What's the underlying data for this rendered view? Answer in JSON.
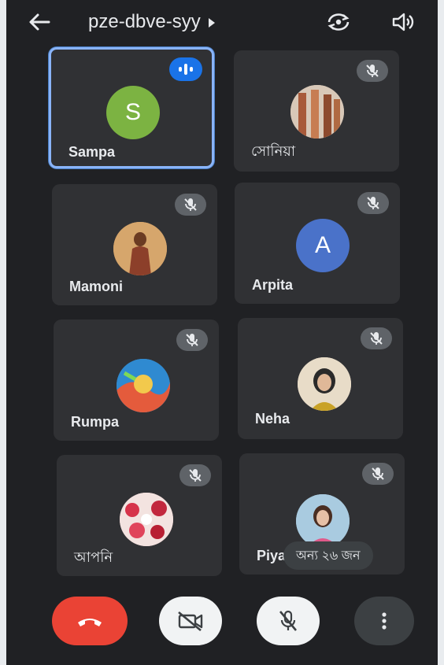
{
  "header": {
    "meeting_code": "pze-dbve-syy",
    "icons": {
      "back": "arrow-left-icon",
      "expand": "play-arrow-icon",
      "switch_camera": "camera-switch-icon",
      "audio": "speaker-icon"
    }
  },
  "participants": [
    {
      "name": "Sampa",
      "avatar_initial": "S",
      "avatar_color": "#7cb342",
      "status": "speaking"
    },
    {
      "name": "সোনিয়া",
      "avatar_initial": "",
      "avatar_color": "#b7a89a",
      "status": "muted"
    },
    {
      "name": "Mamoni",
      "avatar_initial": "",
      "avatar_color": "#c98b52",
      "status": "muted"
    },
    {
      "name": "Arpita",
      "avatar_initial": "A",
      "avatar_color": "#4a72c9",
      "status": "muted"
    },
    {
      "name": "Rumpa",
      "avatar_initial": "",
      "avatar_color": "#3f8ec7",
      "status": "muted"
    },
    {
      "name": "Neha",
      "avatar_initial": "",
      "avatar_color": "#d9c9b3",
      "status": "muted"
    },
    {
      "name": "আপনি",
      "avatar_initial": "",
      "avatar_color": "#e0a3a8",
      "status": "muted"
    },
    {
      "name": "Piya",
      "avatar_initial": "",
      "avatar_color": "#9dbfd4",
      "status": "muted"
    }
  ],
  "others_chip": "অন্য ২৬ জন",
  "controls": {
    "end_call": "call-end-icon",
    "camera": "videocam-off-icon",
    "mic": "mic-off-icon",
    "more": "more-vert-icon"
  },
  "colors": {
    "background": "#202124",
    "tile": "#303134",
    "active_border": "#8ab4f8",
    "end_call": "#ea4335",
    "speaking": "#1a73e8"
  }
}
